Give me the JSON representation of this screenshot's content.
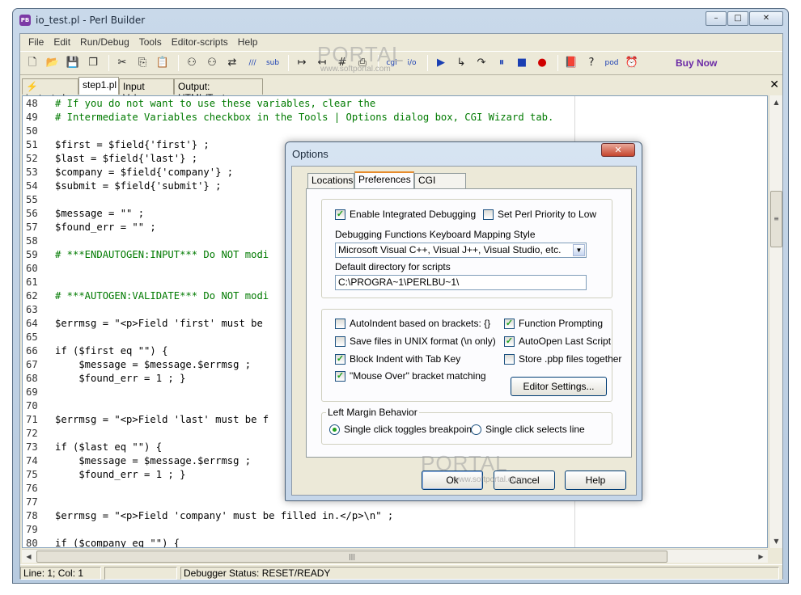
{
  "window": {
    "title": "io_test.pl - Perl Builder",
    "app_icon": "PB",
    "buttons": {
      "minimize": "–",
      "maximize": "□",
      "close": "✕"
    }
  },
  "menu": [
    "File",
    "Edit",
    "Run/Debug",
    "Tools",
    "Editor-scripts",
    "Help"
  ],
  "toolbar": {
    "icons": [
      "new-file-icon",
      "open-folder-icon",
      "save-icon",
      "save-all-icon",
      "cut-icon",
      "copy-icon",
      "paste-icon",
      "find-icon",
      "find-next-icon",
      "replace-icon",
      "comment-icon",
      "sub-icon",
      "indent-icon",
      "outdent-icon",
      "line-number-icon",
      "print-icon",
      "cgi-icon",
      "input-output-icon",
      "run-icon",
      "step-icon",
      "step-over-icon",
      "pause-icon",
      "stop-icon",
      "breakpoint-icon",
      "book-icon",
      "help-icon",
      "pod-icon",
      "clock-icon"
    ],
    "glyphs": [
      "🗋",
      "📂",
      "💾",
      "❐",
      "✂",
      "⎘",
      "📋",
      "⚇",
      "⚇",
      "⇄",
      "///",
      "sub",
      "↦",
      "↤",
      "#",
      "⎙",
      "cgi",
      "i/o",
      "▶",
      "↳",
      "↷",
      "⏸",
      "■",
      "●",
      "📕",
      "?",
      "pod",
      "⏰"
    ],
    "buy_now": "Buy Now"
  },
  "tabs": {
    "items": [
      "io_test.pl",
      "step1.pl",
      "Input Values",
      "Output: HTML/Text"
    ],
    "active_index": 1,
    "close": "✕"
  },
  "editor": {
    "lines": [
      {
        "n": "48",
        "t": "# If you do not want to use these variables, clear the",
        "k": "comment"
      },
      {
        "n": "49",
        "t": "# Intermediate Variables checkbox in the Tools | Options dialog box, CGI Wizard tab.",
        "k": "comment"
      },
      {
        "n": "50",
        "t": "",
        "k": "code"
      },
      {
        "n": "51",
        "t": "$first = $field{'first'} ;",
        "k": "code"
      },
      {
        "n": "52",
        "t": "$last = $field{'last'} ;",
        "k": "code"
      },
      {
        "n": "53",
        "t": "$company = $field{'company'} ;",
        "k": "code"
      },
      {
        "n": "54",
        "t": "$submit = $field{'submit'} ;",
        "k": "code"
      },
      {
        "n": "55",
        "t": "",
        "k": "code"
      },
      {
        "n": "56",
        "t": "$message = \"\" ;",
        "k": "code"
      },
      {
        "n": "57",
        "t": "$found_err = \"\" ;",
        "k": "code"
      },
      {
        "n": "58",
        "t": "",
        "k": "code"
      },
      {
        "n": "59",
        "t": "# ***ENDAUTOGEN:INPUT*** Do NOT modi                                             ne.",
        "k": "comment"
      },
      {
        "n": "60",
        "t": "",
        "k": "code"
      },
      {
        "n": "61",
        "t": "",
        "k": "code"
      },
      {
        "n": "62",
        "t": "# ***AUTOGEN:VALIDATE*** Do NOT modi                                             .",
        "k": "comment"
      },
      {
        "n": "63",
        "t": "",
        "k": "code"
      },
      {
        "n": "64",
        "t": "$errmsg = \"<p>Field 'first' must be",
        "k": "code"
      },
      {
        "n": "65",
        "t": "",
        "k": "code"
      },
      {
        "n": "66",
        "t": "if ($first eq \"\") {",
        "k": "code"
      },
      {
        "n": "67",
        "t": "    $message = $message.$errmsg ;",
        "k": "code"
      },
      {
        "n": "68",
        "t": "    $found_err = 1 ; }",
        "k": "code"
      },
      {
        "n": "69",
        "t": "",
        "k": "code"
      },
      {
        "n": "70",
        "t": "",
        "k": "code"
      },
      {
        "n": "71",
        "t": "$errmsg = \"<p>Field 'last' must be f",
        "k": "code"
      },
      {
        "n": "72",
        "t": "",
        "k": "code"
      },
      {
        "n": "73",
        "t": "if ($last eq \"\") {",
        "k": "code"
      },
      {
        "n": "74",
        "t": "    $message = $message.$errmsg ;",
        "k": "code"
      },
      {
        "n": "75",
        "t": "    $found_err = 1 ; }",
        "k": "code"
      },
      {
        "n": "76",
        "t": "",
        "k": "code"
      },
      {
        "n": "77",
        "t": "",
        "k": "code"
      },
      {
        "n": "78",
        "t": "$errmsg = \"<p>Field 'company' must be filled in.</p>\\n\" ;",
        "k": "code"
      },
      {
        "n": "79",
        "t": "",
        "k": "code"
      },
      {
        "n": "80",
        "t": "if ($company eq \"\") {",
        "k": "code"
      }
    ]
  },
  "statusbar": {
    "position": "Line: 1; Col: 1",
    "debugger": "Debugger Status: RESET/READY"
  },
  "dialog": {
    "title": "Options",
    "close": "✕",
    "tabs": [
      "Locations",
      "Preferences",
      "CGI Wizard"
    ],
    "active_tab": 1,
    "debug": {
      "enable_debugging": {
        "label": "Enable Integrated Debugging",
        "checked": true
      },
      "perl_priority": {
        "label": "Set Perl Priority to Low",
        "checked": false
      },
      "mapping_label": "Debugging Functions Keyboard Mapping Style",
      "mapping_value": "Microsoft Visual C++, Visual J++, Visual Studio, etc.",
      "dir_label": "Default directory for scripts",
      "dir_value": "C:\\PROGRA~1\\PERLBU~1\\"
    },
    "editor_opts": {
      "left": [
        {
          "label": "AutoIndent based on brackets: {}",
          "checked": false
        },
        {
          "label": "Save files in UNIX format (\\n only)",
          "checked": false
        },
        {
          "label": "Block Indent with Tab Key",
          "checked": true
        },
        {
          "label": "\"Mouse Over\" bracket matching",
          "checked": true
        }
      ],
      "right": [
        {
          "label": "Function Prompting",
          "checked": true
        },
        {
          "label": "AutoOpen Last Script",
          "checked": true
        },
        {
          "label": "Store .pbp files together",
          "checked": false
        }
      ],
      "settings_button": "Editor Settings..."
    },
    "margin": {
      "label": "Left Margin Behavior",
      "options": [
        {
          "label": "Single click toggles breakpoint",
          "selected": true
        },
        {
          "label": "Single click selects line",
          "selected": false
        }
      ]
    },
    "buttons": {
      "ok": "Ok",
      "cancel": "Cancel",
      "help": "Help"
    }
  },
  "watermark": {
    "brand": "PORTAL",
    "url": "www.softportal.com"
  }
}
